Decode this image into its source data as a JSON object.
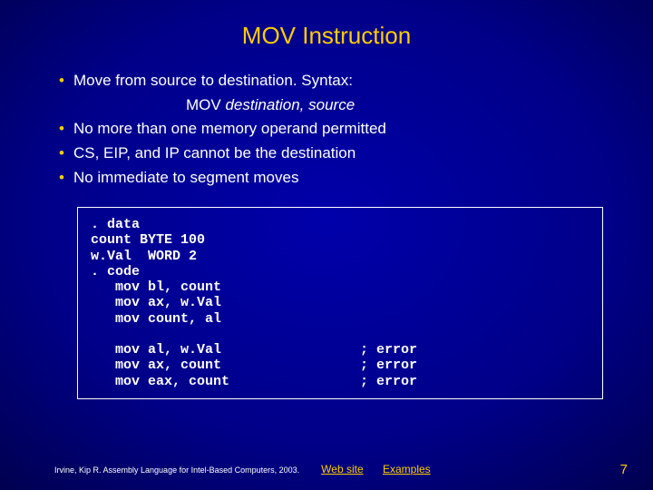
{
  "title": "MOV Instruction",
  "bullets": [
    "Move from source to destination. Syntax:",
    "No more than one memory operand permitted",
    "CS, EIP, and IP cannot be the destination",
    "No immediate to segment moves"
  ],
  "syntax": {
    "op": "MOV ",
    "args": "destination, source"
  },
  "code": ". data\ncount BYTE 100\nw.Val  WORD 2\n. code\n   mov bl, count\n   mov ax, w.Val\n   mov count, al\n\n   mov al, w.Val                 ; error\n   mov ax, count                 ; error\n   mov eax, count                ; error",
  "footer": {
    "citation": "Irvine, Kip R. Assembly Language for Intel-Based Computers, 2003.",
    "link1": "Web site",
    "link2": "Examples",
    "page": "7"
  }
}
